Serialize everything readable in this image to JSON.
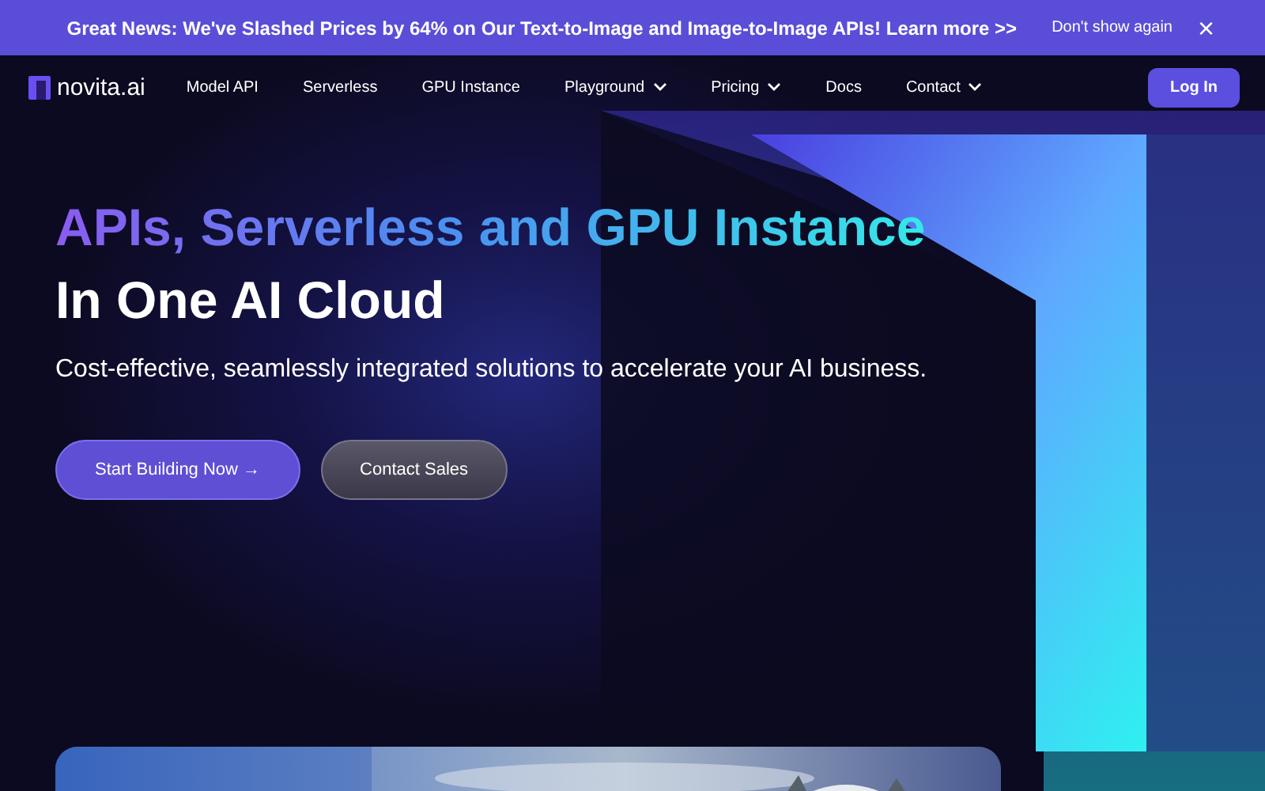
{
  "banner": {
    "message": "Great News: We've Slashed Prices by 64% on Our Text-to-Image and Image-to-Image APIs! Learn more >>",
    "dismiss": "Don't show again",
    "close": "×"
  },
  "nav": {
    "logo": "novita.ai",
    "items": [
      {
        "label": "Model API",
        "has_menu": false
      },
      {
        "label": "Serverless",
        "has_menu": false
      },
      {
        "label": "GPU Instance",
        "has_menu": false
      },
      {
        "label": "Playground",
        "has_menu": true
      },
      {
        "label": "Pricing",
        "has_menu": true
      },
      {
        "label": "Docs",
        "has_menu": false
      },
      {
        "label": "Contact",
        "has_menu": true
      }
    ],
    "login": "Log In"
  },
  "hero": {
    "headline": "APIs, Serverless and GPU Instance",
    "headline_2": "In One AI Cloud",
    "subtitle": "Cost-effective, seamlessly integrated solutions to accelerate your AI business.",
    "buttons": [
      {
        "label": "Start Building Now →",
        "kind": "primary"
      },
      {
        "label": "Contact Sales",
        "kind": "secondary"
      }
    ]
  }
}
